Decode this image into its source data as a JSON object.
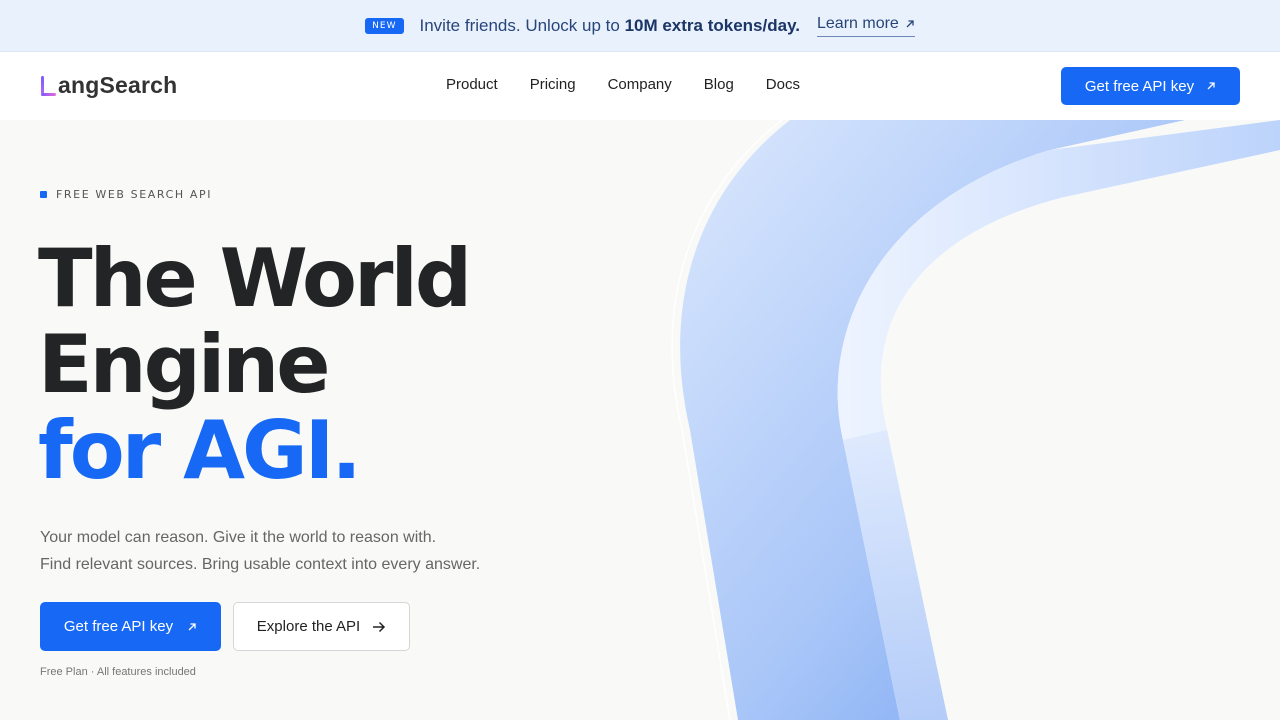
{
  "announcement": {
    "badge": "NEW",
    "text_prefix": "Invite friends. Unlock up to",
    "text_bold": "10M extra tokens/day.",
    "link_label": "Learn more",
    "link_icon": "arrow-up-right-icon"
  },
  "nav": {
    "logo_text": "angSearch",
    "links": [
      {
        "label": "Product"
      },
      {
        "label": "Pricing"
      },
      {
        "label": "Company"
      },
      {
        "label": "Blog"
      },
      {
        "label": "Docs"
      }
    ],
    "cta_label": "Get free API key",
    "cta_icon": "arrow-up-right-icon"
  },
  "hero": {
    "eyebrow": "FREE WEB SEARCH API",
    "headline_line1": "The World",
    "headline_line2": "Engine",
    "headline_line3": "for AGI.",
    "subtitle_line1": "Your model can reason. Give it the world to reason with.",
    "subtitle_line2": "Find relevant sources. Bring usable context into every answer.",
    "primary_cta": "Get free API key",
    "secondary_cta": "Explore the API",
    "secondary_icon": "arrow-right-icon",
    "fine_print": "Free Plan · All features included"
  },
  "colors": {
    "accent": "#1769f5",
    "headline": "#232425",
    "banner_bg": "#e9f1fd",
    "page_bg": "#f9f9f8"
  }
}
